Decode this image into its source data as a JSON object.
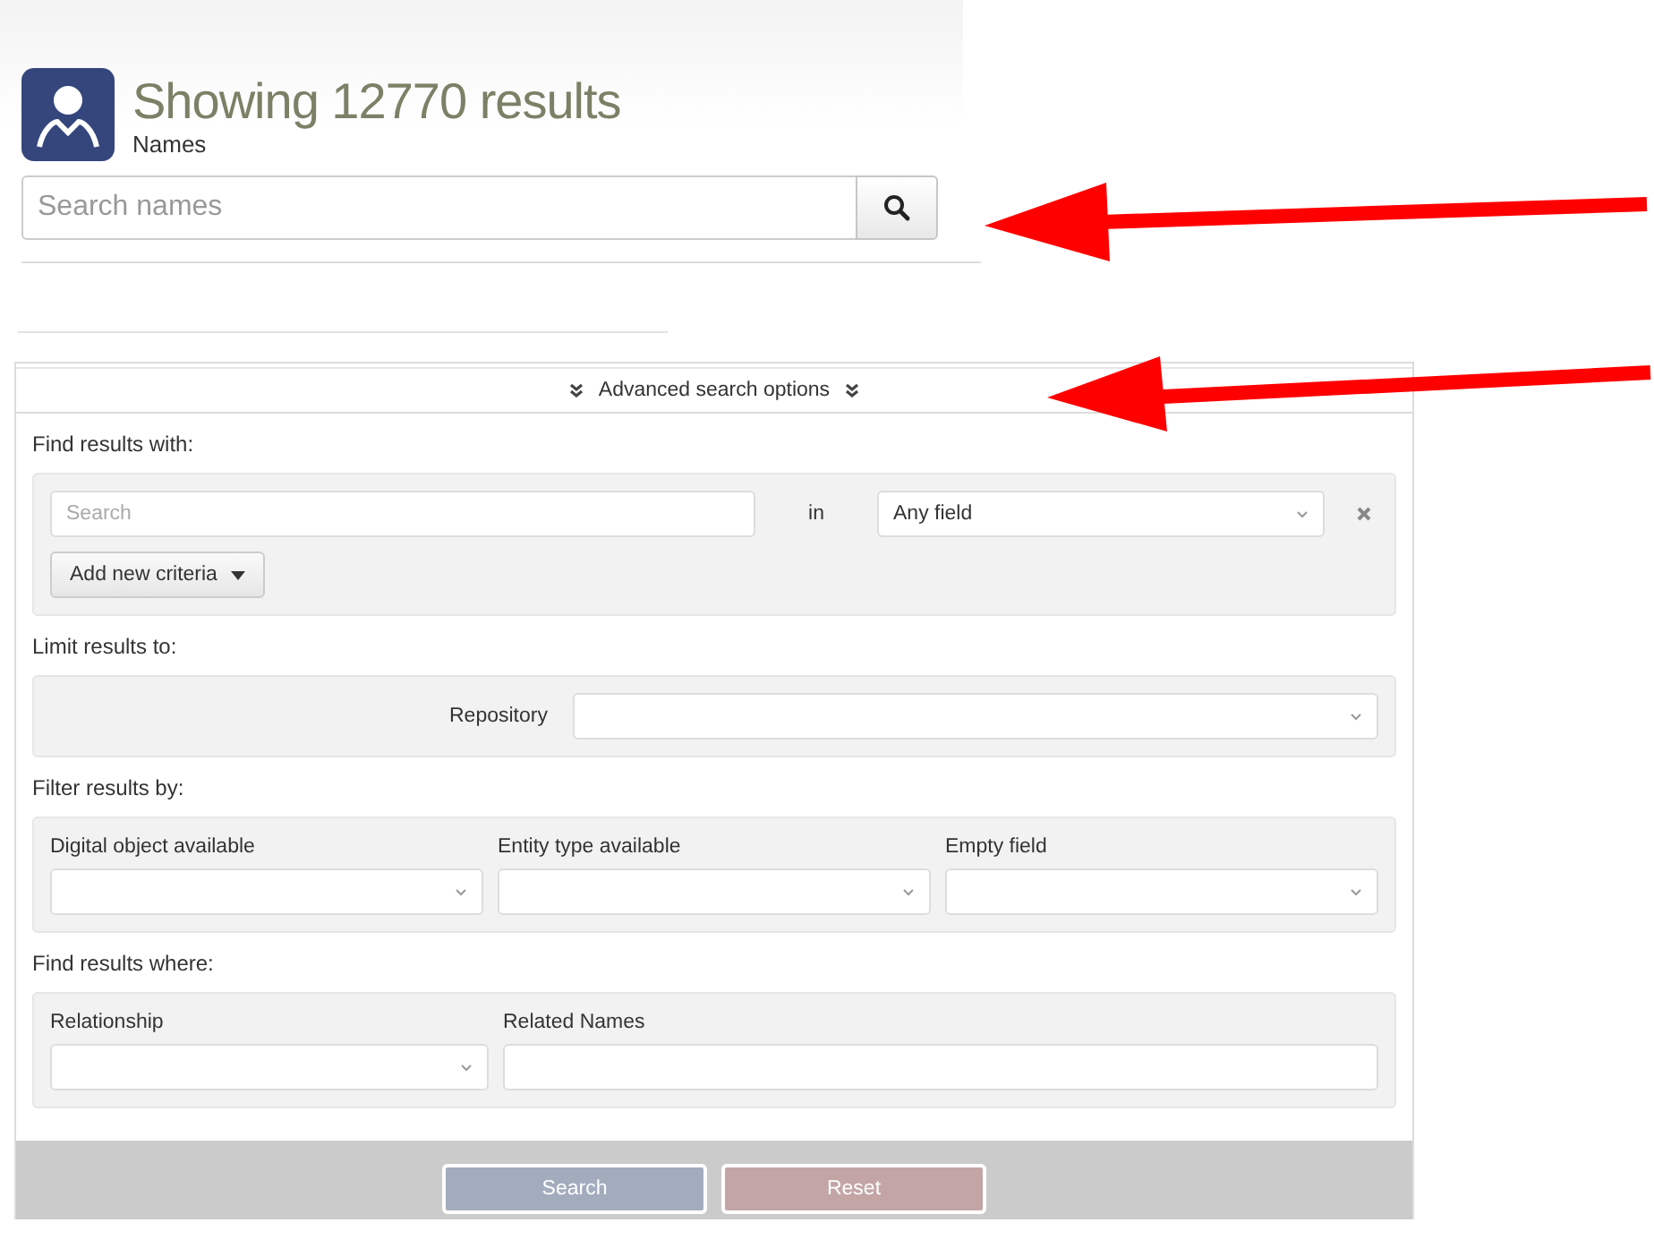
{
  "header": {
    "title": "Showing 12770 results",
    "subtitle": "Names"
  },
  "search": {
    "placeholder": "Search names"
  },
  "advanced": {
    "label": "Advanced search options",
    "expanded": true
  },
  "criteria": {
    "heading": "Find results with:",
    "placeholder": "Search",
    "joiner": "in",
    "field": "Any field",
    "add_button": "Add new criteria"
  },
  "limit": {
    "heading": "Limit results to:",
    "label": "Repository"
  },
  "filters": {
    "heading": "Filter results by:",
    "items": [
      {
        "label": "Digital object available",
        "kind": "select"
      },
      {
        "label": "Entity type available",
        "kind": "select"
      },
      {
        "label": "Empty field",
        "kind": "select"
      }
    ]
  },
  "where": {
    "heading": "Find results where:",
    "items": [
      {
        "label": "Relationship",
        "kind": "select"
      },
      {
        "label": "Related Names",
        "kind": "text"
      }
    ]
  },
  "buttons": [
    {
      "label": "Search",
      "kind": "primary"
    },
    {
      "label": "Reset",
      "kind": "danger"
    }
  ]
}
